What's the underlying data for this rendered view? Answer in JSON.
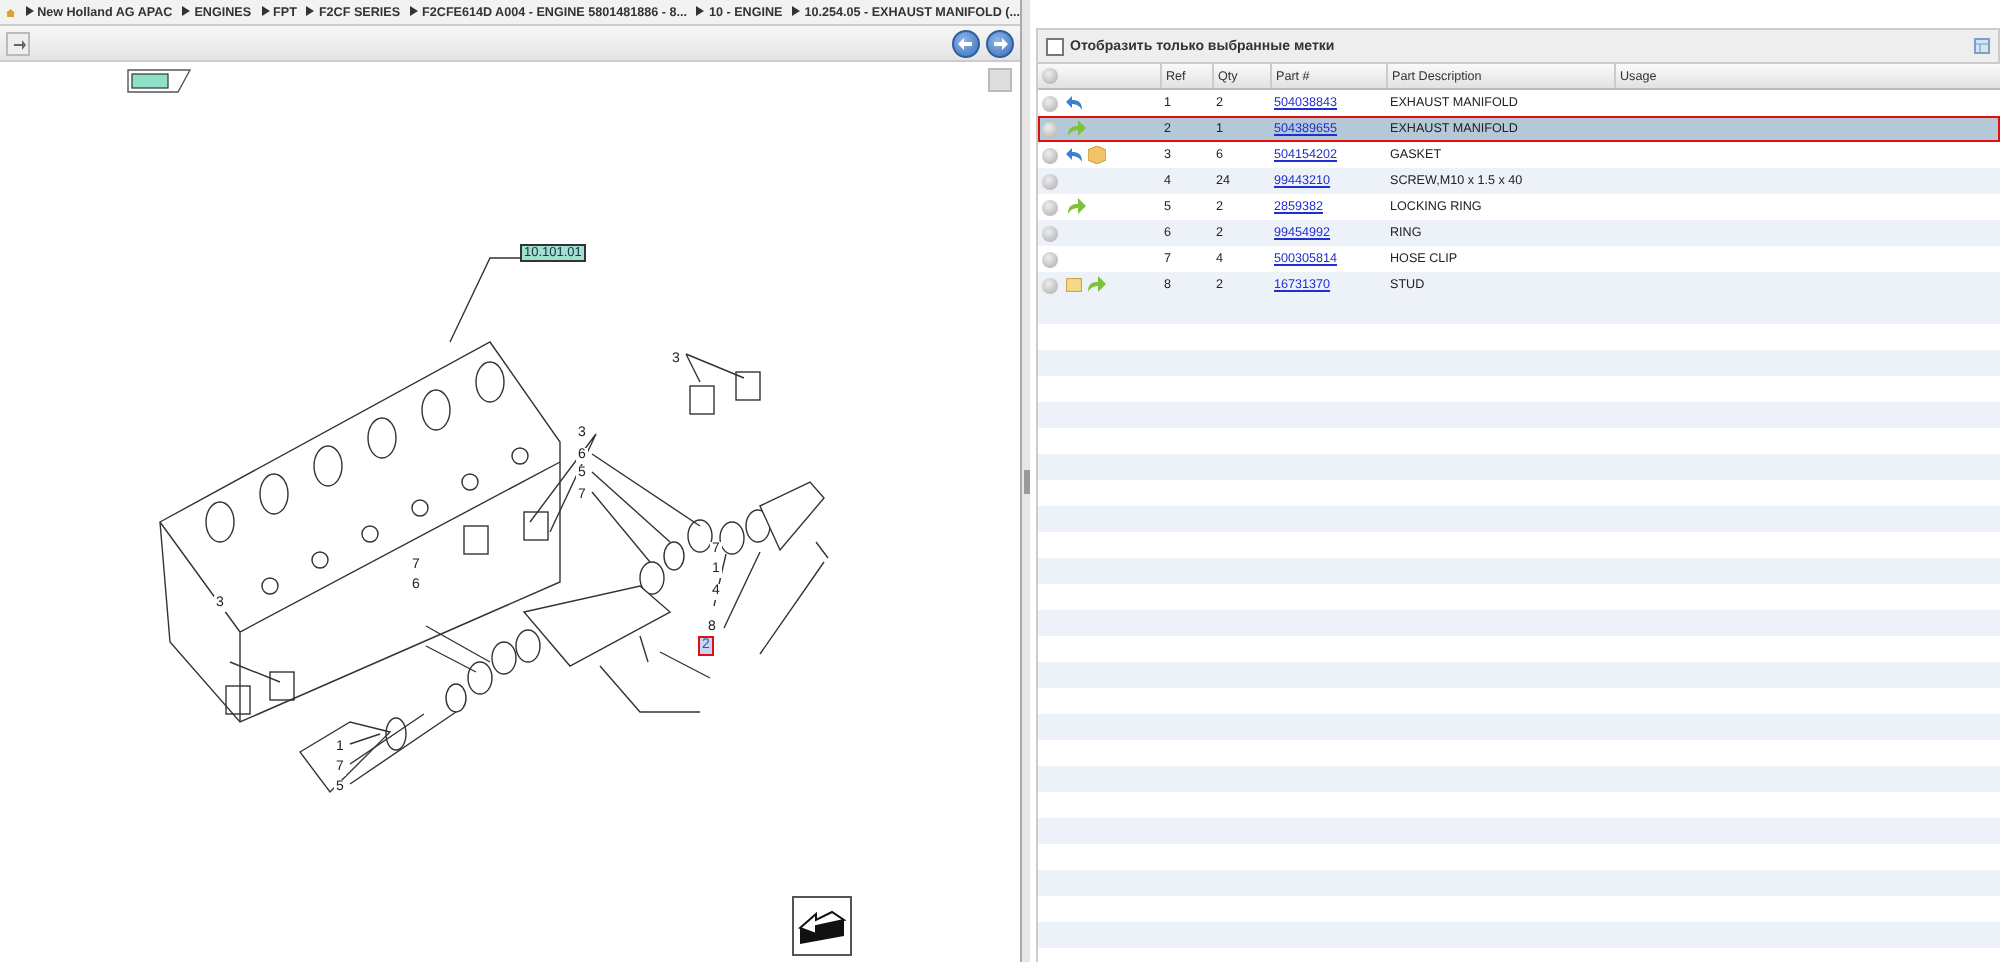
{
  "breadcrumb": [
    "New Holland AG APAC",
    "ENGINES",
    "FPT",
    "F2CF SERIES",
    "F2CFE614D A004 - ENGINE 5801481886 - 8...",
    "10 - ENGINE",
    "10.254.05 - EXHAUST MANIFOLD (..."
  ],
  "diagram": {
    "reference_tag": "10.101.01",
    "callouts": [
      {
        "text": "3",
        "selected": false
      },
      {
        "text": "3",
        "selected": false
      },
      {
        "text": "6",
        "selected": false
      },
      {
        "text": "5",
        "selected": false
      },
      {
        "text": "7",
        "selected": false
      },
      {
        "text": "7",
        "selected": false
      },
      {
        "text": "6",
        "selected": false
      },
      {
        "text": "3",
        "selected": false
      },
      {
        "text": "7",
        "selected": false
      },
      {
        "text": "1",
        "selected": false
      },
      {
        "text": "4",
        "selected": false
      },
      {
        "text": "8",
        "selected": false
      },
      {
        "text": "2",
        "selected": true
      },
      {
        "text": "1",
        "selected": false
      },
      {
        "text": "7",
        "selected": false
      },
      {
        "text": "5",
        "selected": false
      }
    ]
  },
  "filter": {
    "label": "Отобразить только выбранные метки",
    "checked": false
  },
  "table": {
    "columns": [
      "Ref",
      "Qty",
      "Part #",
      "Part Description",
      "Usage"
    ],
    "rows": [
      {
        "icons": [
          {
            "kind": "back"
          }
        ],
        "ref": "1",
        "qty": "2",
        "part": "504038843",
        "description": "EXHAUST MANIFOLD",
        "selected": false
      },
      {
        "icons": [
          {
            "kind": "forward"
          }
        ],
        "ref": "2",
        "qty": "1",
        "part": "504389655",
        "description": "EXHAUST MANIFOLD",
        "selected": true
      },
      {
        "icons": [
          {
            "kind": "back"
          },
          {
            "kind": "package"
          }
        ],
        "ref": "3",
        "qty": "6",
        "part": "504154202",
        "description": "GASKET",
        "selected": false
      },
      {
        "icons": [],
        "ref": "4",
        "qty": "24",
        "part": "99443210",
        "description": "SCREW,M10 x 1.5 x 40",
        "selected": false
      },
      {
        "icons": [
          {
            "kind": "forward"
          }
        ],
        "ref": "5",
        "qty": "2",
        "part": "2859382",
        "description": "LOCKING RING",
        "selected": false
      },
      {
        "icons": [],
        "ref": "6",
        "qty": "2",
        "part": "99454992",
        "description": "RING",
        "selected": false
      },
      {
        "icons": [],
        "ref": "7",
        "qty": "4",
        "part": "500305814",
        "description": "HOSE CLIP",
        "selected": false
      },
      {
        "icons": [
          {
            "kind": "note"
          },
          {
            "kind": "forward"
          }
        ],
        "ref": "8",
        "qty": "2",
        "part": "16731370",
        "description": "STUD",
        "selected": false
      }
    ]
  }
}
